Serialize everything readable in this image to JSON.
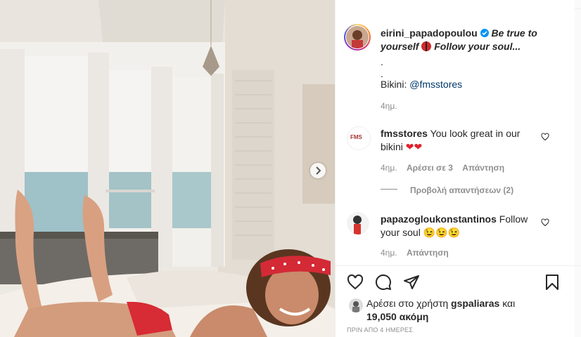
{
  "post": {
    "username": "eirini_papadopoulou",
    "caption_line1": "Be true to",
    "caption_line2": "yourself",
    "caption_line2b": "Follow your soul...",
    "dot1": ".",
    "dot2": ".",
    "bikini_label": "Bikini:",
    "bikini_link": "@fmsstores",
    "time": "4ημ."
  },
  "comments": [
    {
      "username": "fmsstores",
      "text": "You look great in our",
      "text2": "bikini",
      "emoji": "❤❤",
      "time": "4ημ.",
      "likes": "Αρέσει σε 3",
      "reply": "Απάντηση",
      "view_replies": "Προβολή απαντήσεων (2)",
      "avatar_text": "FMS"
    },
    {
      "username": "papazogloukonstantinos",
      "text": "Follow",
      "text2": "your soul",
      "emoji": "😉😉😉",
      "time": "4ημ.",
      "reply": "Απάντηση"
    }
  ],
  "likes": {
    "prefix": "Αρέσει στο χρήστη",
    "user": "gspaliaras",
    "and": "και",
    "count": "19,050 ακόμη"
  },
  "posted": "ΠΡΙΝ ΑΠΟ 4 ΗΜΕΡΕΣ",
  "colors": {
    "verified": "#0095f6",
    "accent_red": "#ed4956"
  },
  "icons": [
    "heart-icon",
    "comment-icon",
    "share-icon",
    "bookmark-icon",
    "next-arrow-icon",
    "verified-icon",
    "ladybug-icon"
  ]
}
